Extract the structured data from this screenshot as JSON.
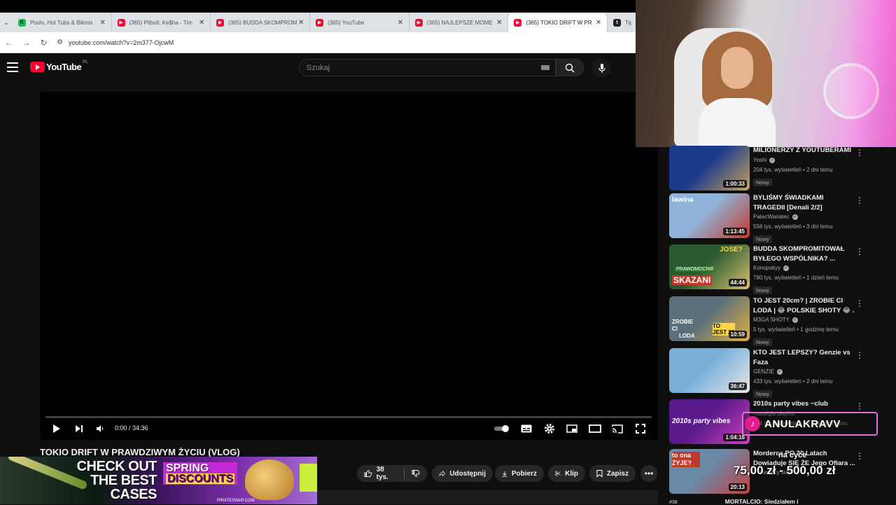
{
  "browser": {
    "tabs": [
      {
        "title": "Pools, Hot Tubs & Bikinis",
        "icon": "kick-icon"
      },
      {
        "title": "(365) Pitbull, Ke$ha - Tim",
        "icon": "youtube-icon"
      },
      {
        "title": "(365) BUDDA SKOMPROM",
        "icon": "youtube-icon"
      },
      {
        "title": "(365) YouTube",
        "icon": "youtube-icon"
      },
      {
        "title": "(365) NAJLEPSZE MOME",
        "icon": "youtube-icon"
      },
      {
        "title": "(365) TOKIO DRIFT W PR",
        "icon": "youtube-icon",
        "active": true
      },
      {
        "title": "Tipp",
        "icon": "tipply-icon"
      }
    ],
    "url": "youtube.com/watch?v=2m377-OjcwM"
  },
  "youtube": {
    "logo_text": "YouTube",
    "region": "PL",
    "search_placeholder": "Szukaj"
  },
  "player": {
    "time": "0:00 / 34:36",
    "progress": 0.0
  },
  "video": {
    "title": "TOKIO DRIFT W PRAWDZIWYM ŻYCIU (VLOG)",
    "likes": "38 tys.",
    "share_label": "Udostępnij",
    "download_label": "Pobierz",
    "clip_label": "Klip",
    "save_label": "Zapisz"
  },
  "ad": {
    "line1": "CHECK OUT THE BEST CASES",
    "line2a": "SPRING",
    "line2b": "DISCOUNTS",
    "domain": "PIRATESWAP.COM"
  },
  "sidebar": [
    {
      "title": "MILIONERZY Z YOUTUBERAMI",
      "title2": "",
      "channel": "Yoshi",
      "views": "204 tys. wyświetleń • 2 dni temu",
      "badge": "Nowy",
      "duration": "1:00:33",
      "colors": [
        "#1a3a8c",
        "#c5a060"
      ]
    },
    {
      "title": "BYLIŚMY ŚWIADKAMI",
      "title2": "TRAGEDII [Denali 2/2]",
      "channel": "PatecWariatec",
      "views": "556 tys. wyświetleń • 3 dni temu",
      "badge": "Nowy",
      "duration": "1:13:45",
      "colors": [
        "#8fb3d8",
        "#c0392b"
      ]
    },
    {
      "title": "BUDDA SKOMPROMITOWAŁ",
      "title2": "BYŁEGO WSPÓLNIKA? ...",
      "channel": "Konopskyy",
      "views": "780 tys. wyświetleń • 1 dzień temu",
      "badge": "Nowy",
      "duration": "44:44",
      "colors": [
        "#2a5a30",
        "#d8c070"
      ]
    },
    {
      "title": "TO JEST 20cm? | ZROBIE CI",
      "title2": "LODA | 😂 POLSKIE SHOTY 😂 ...",
      "channel": "M3GA SHOTY",
      "views": "5 tys. wyświetleń • 1 godzinę temu",
      "badge": "Nowy",
      "duration": "10:59",
      "colors": [
        "#5a6f7a",
        "#e0b040"
      ]
    },
    {
      "title": "KTO JEST LEPSZY? Genzie vs",
      "title2": "Faza",
      "channel": "GENZIE",
      "views": "433 tys. wyświetleń • 2 dni temu",
      "badge": "Nowy",
      "duration": "36:47",
      "colors": [
        "#7ab0d8",
        "#e8e8e8"
      ]
    },
    {
      "title": "2010s party vibes ~club",
      "title2": "",
      "channel": "nostalgia playlist",
      "views": "314 tys. wyświetleń • 4 miesiące temu",
      "badge": "",
      "duration": "1:04:16",
      "colors": [
        "#5a1a8a",
        "#d040c0"
      ]
    },
    {
      "title": "Morderca PO 20 Latach",
      "title2": "Dowiaduje SIĘ ŻE Jego Ofiara ...",
      "channel": "",
      "views": "7 miesięcy temu",
      "badge": "",
      "duration": "20:13",
      "colors": [
        "#6a8aa8",
        "#c04040"
      ]
    }
  ],
  "sidebar_last_title": "MORTALCIO: Siedziałem i",
  "overlay": {
    "donor": "ANULAKRAVV",
    "message": "na cyce",
    "amount": "75,00 zł - 500,00 zł",
    "rank": "#38"
  },
  "thumb_texts": {
    "t2": "lawina",
    "t3a": "JOSE?",
    "t3b": "PRAWOMOCNIE",
    "t3c": "SKAZANI",
    "t4a": "ZROBIE CI",
    "t4b": "LODA",
    "t4c": "TO JEST 20",
    "t6": "2010s party vibes",
    "t7": "to ona ŻYJE?"
  }
}
